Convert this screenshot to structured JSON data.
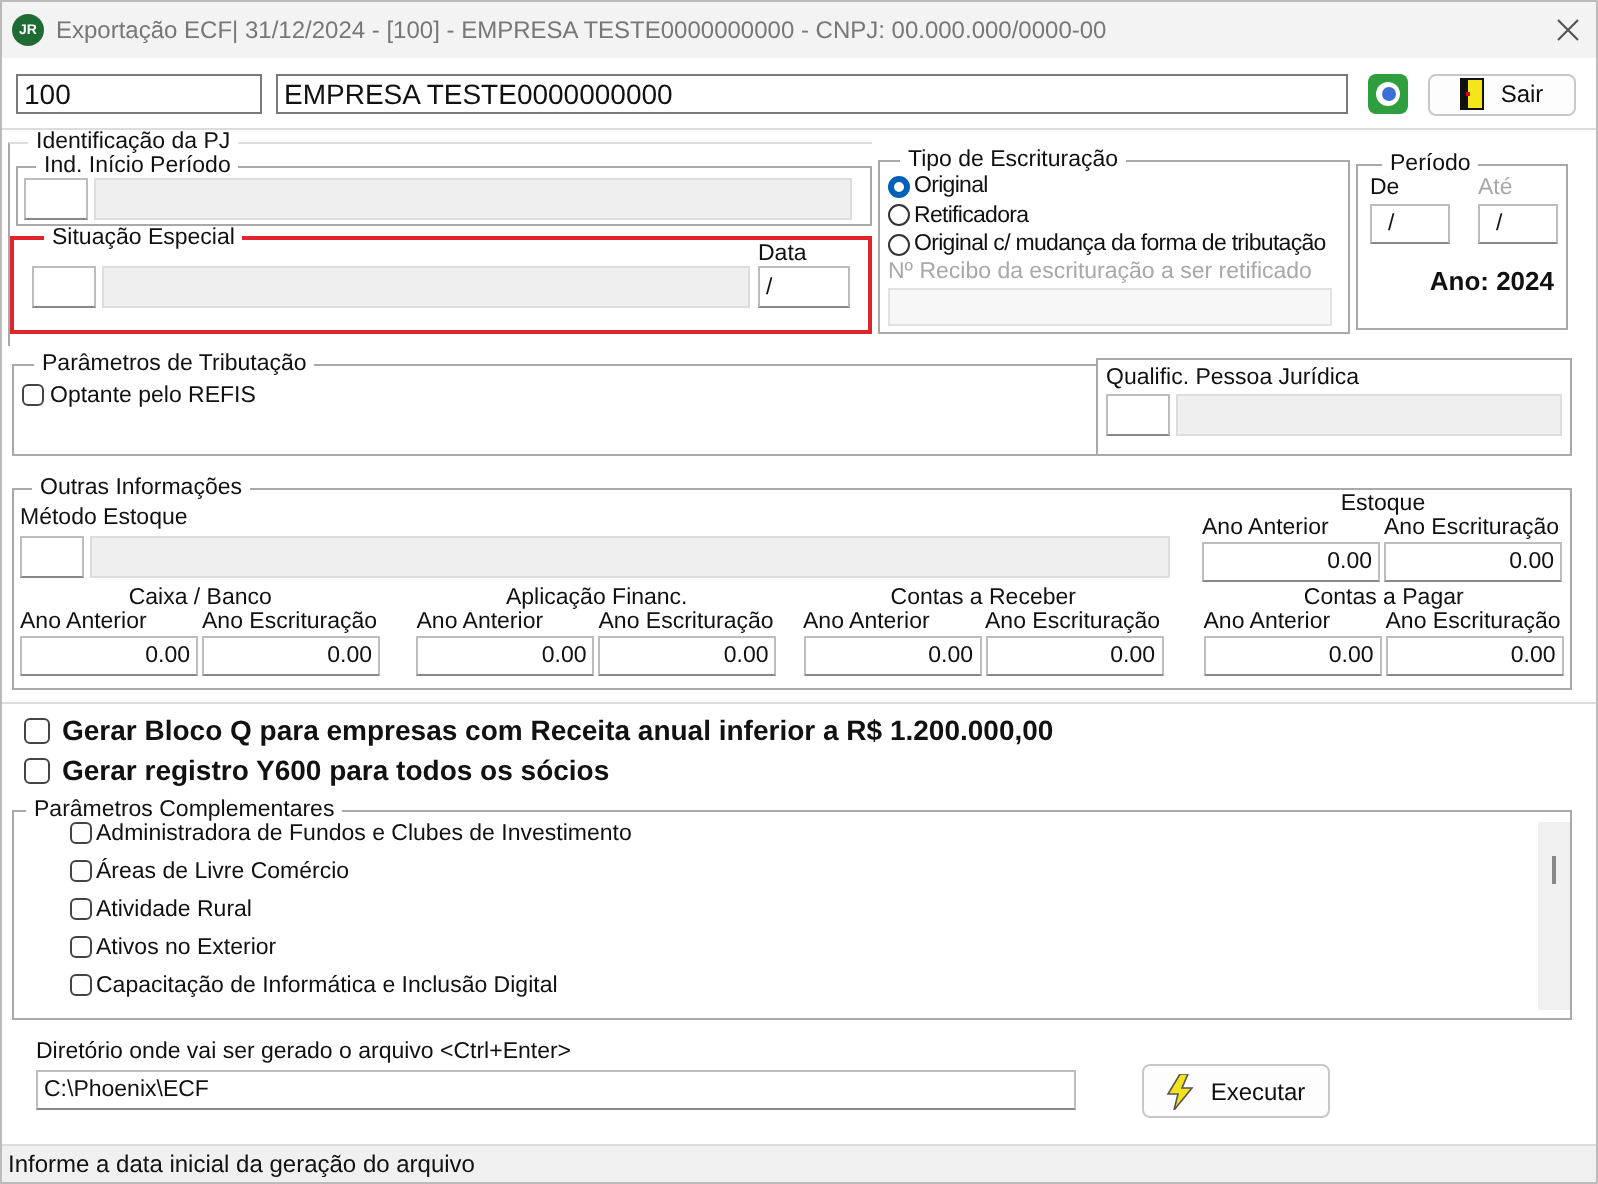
{
  "window": {
    "logo": "JR",
    "title": "Exportação ECF|  31/12/2024 - [100] - EMPRESA TESTE0000000000 - CNPJ: 00.000.000/0000-00"
  },
  "company": {
    "code": "100",
    "name": "EMPRESA TESTE0000000000"
  },
  "exit_button": "Sair",
  "identificacao": {
    "title": "Identificação da PJ",
    "inicio": {
      "title": "Ind. Início Período"
    },
    "situacao": {
      "title": "Situação Especial",
      "highlighted": true,
      "date_label": "Data",
      "date_value": "/"
    }
  },
  "tipo": {
    "title": "Tipo de Escrituração",
    "options": [
      {
        "label": "Original",
        "selected": true
      },
      {
        "label": "Retificadora",
        "selected": false
      },
      {
        "label": "Original c/ mudança da forma de tributação",
        "selected": false
      }
    ],
    "receipt": {
      "label": "Nº Recibo da escrituração a ser retificado",
      "disabled": true
    }
  },
  "periodo": {
    "title": "Período",
    "from": {
      "label": "De",
      "value": "/",
      "disabled": false
    },
    "to": {
      "label": "Até",
      "value": "/",
      "disabled": true
    },
    "year": "Ano: 2024"
  },
  "tributacao": {
    "title": "Parâmetros de Tributação",
    "options": [
      {
        "label": "Optante pelo REFIS",
        "checked": false
      }
    ]
  },
  "qualificacao": {
    "title": "Qualific. Pessoa Jurídica"
  },
  "outras": {
    "title": "Outras Informações",
    "metodo_label": "Método Estoque",
    "estoque": {
      "title": "Estoque",
      "prev_label": "Ano Anterior",
      "prev_value": "0.00",
      "cur_label": "Ano Escrituração",
      "cur_value": "0.00"
    },
    "groups": [
      {
        "title": "Caixa / Banco",
        "prev_label": "Ano  Anterior",
        "prev_value": "0.00",
        "cur_label": "Ano Escrituração",
        "cur_value": "0.00"
      },
      {
        "title": "Aplicação Financ.",
        "prev_label": "Ano  Anterior",
        "prev_value": "0.00",
        "cur_label": "Ano Escrituração",
        "cur_value": "0.00"
      },
      {
        "title": "Contas a Receber",
        "prev_label": "Ano Anterior",
        "prev_value": "0.00",
        "cur_label": "Ano Escrituração",
        "cur_value": "0.00"
      },
      {
        "title": "Contas a Pagar",
        "prev_label": "Ano Anterior",
        "prev_value": "0.00",
        "cur_label": "Ano Escrituração",
        "cur_value": "0.00"
      }
    ]
  },
  "options": [
    {
      "label": "Gerar Bloco Q para empresas com Receita anual inferior a R$ 1.200.000,00",
      "checked": false
    },
    {
      "label": "Gerar registro Y600 para todos os sócios",
      "checked": false
    }
  ],
  "complementares": {
    "title": "Parâmetros Complementares",
    "items": [
      {
        "label": "Administradora de Fundos e Clubes de Investimento",
        "checked": false
      },
      {
        "label": "Áreas de Livre Comércio",
        "checked": false
      },
      {
        "label": "Atividade Rural",
        "checked": false
      },
      {
        "label": "Ativos no Exterior",
        "checked": false
      },
      {
        "label": "Capacitação de Informática e Inclusão Digital",
        "checked": false
      }
    ]
  },
  "output": {
    "label": "Diretório onde vai ser gerado o arquivo <Ctrl+Enter>",
    "value": "C:\\Phoenix\\ECF"
  },
  "run_button": "Executar",
  "status_bar": "Informe a data inicial da geração do arquivo"
}
